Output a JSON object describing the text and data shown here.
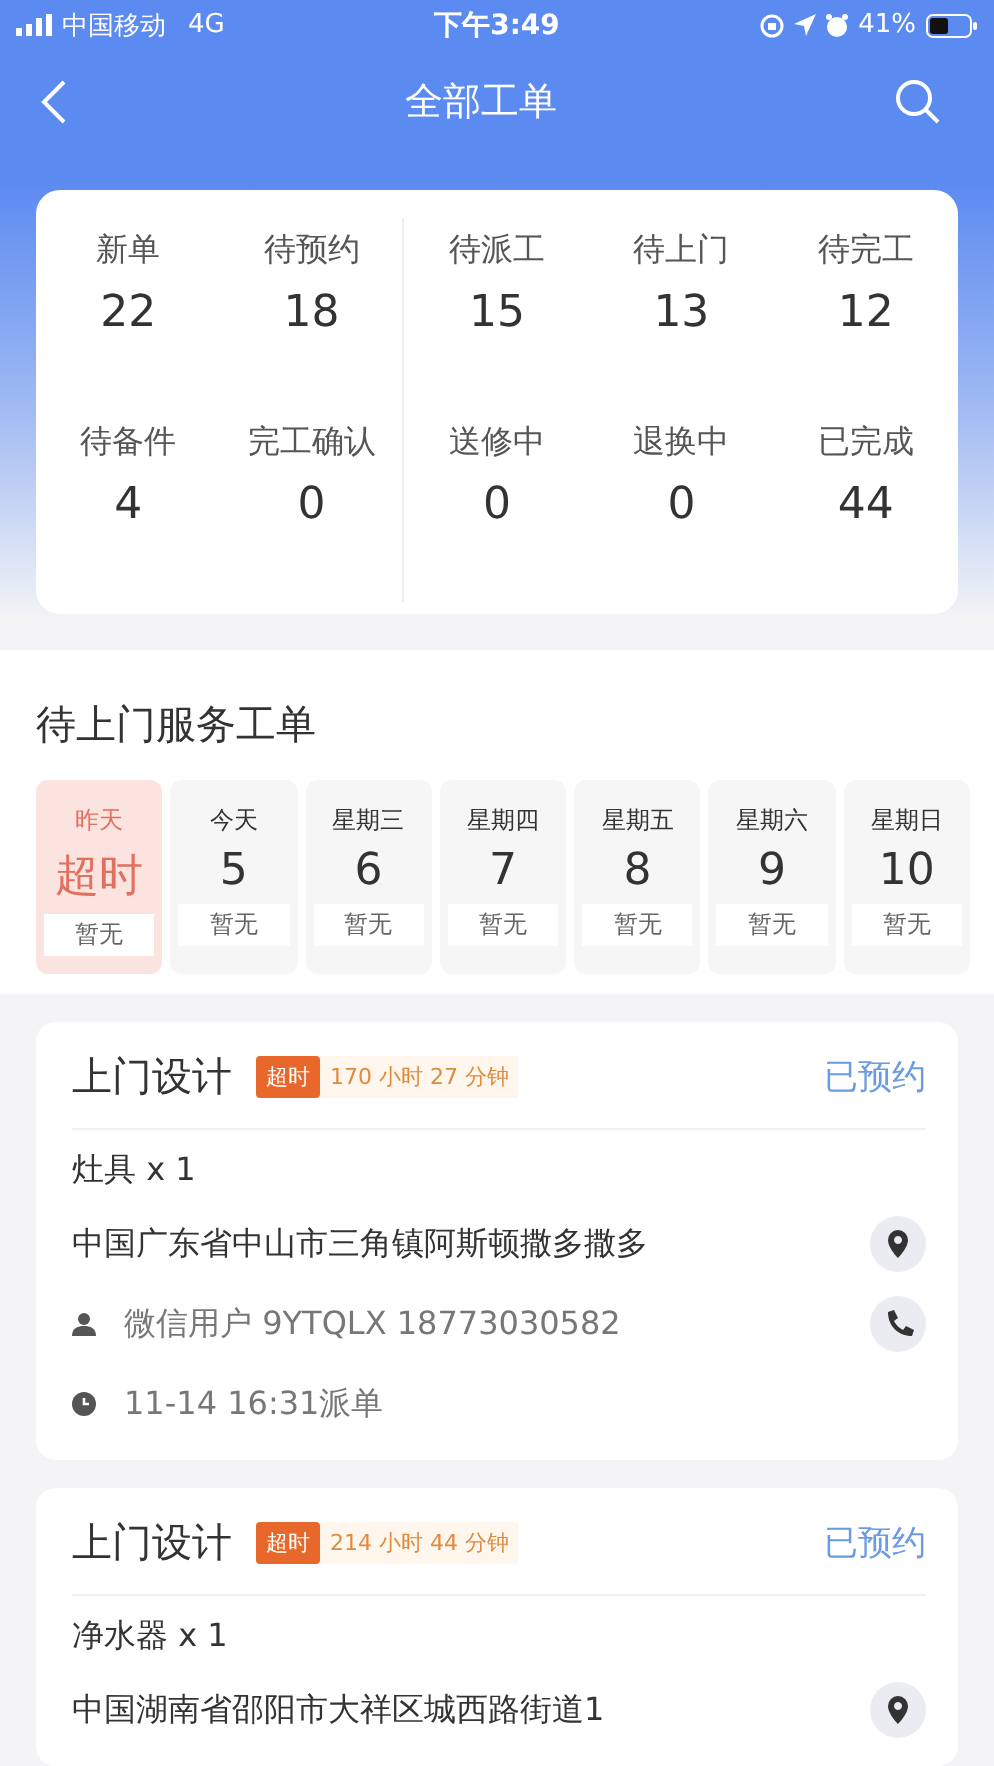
{
  "status_bar": {
    "carrier": "中国移动",
    "network": "4G",
    "time": "下午3:49",
    "battery": "41%"
  },
  "nav": {
    "title": "全部工单"
  },
  "stats": [
    {
      "label": "新单",
      "value": "22"
    },
    {
      "label": "待预约",
      "value": "18"
    },
    {
      "label": "待派工",
      "value": "15"
    },
    {
      "label": "待上门",
      "value": "13"
    },
    {
      "label": "待完工",
      "value": "12"
    },
    {
      "label": "待备件",
      "value": "4"
    },
    {
      "label": "完工确认",
      "value": "0"
    },
    {
      "label": "送修中",
      "value": "0"
    },
    {
      "label": "退换中",
      "value": "0"
    },
    {
      "label": "已完成",
      "value": "44"
    }
  ],
  "section": {
    "title": "待上门服务工单"
  },
  "days": [
    {
      "label": "昨天",
      "value": "超时",
      "note": "暂无",
      "selected": true
    },
    {
      "label": "今天",
      "value": "5",
      "note": "暂无",
      "selected": false
    },
    {
      "label": "星期三",
      "value": "6",
      "note": "暂无",
      "selected": false
    },
    {
      "label": "星期四",
      "value": "7",
      "note": "暂无",
      "selected": false
    },
    {
      "label": "星期五",
      "value": "8",
      "note": "暂无",
      "selected": false
    },
    {
      "label": "星期六",
      "value": "9",
      "note": "暂无",
      "selected": false
    },
    {
      "label": "星期日",
      "value": "10",
      "note": "暂无",
      "selected": false
    }
  ],
  "orders": [
    {
      "title": "上门设计",
      "badge": "超时",
      "duration": "170 小时 27 分钟",
      "status": "已预约",
      "product": "灶具 x 1",
      "address": "中国广东省中山市三角镇阿斯顿撒多撒多",
      "contact": "微信用户 9YTQLX 18773030582",
      "time": "11-14 16:31派单"
    },
    {
      "title": "上门设计",
      "badge": "超时",
      "duration": "214 小时 44 分钟",
      "status": "已预约",
      "product": "净水器 x 1",
      "address": "中国湖南省邵阳市大祥区城西路街道1"
    }
  ]
}
